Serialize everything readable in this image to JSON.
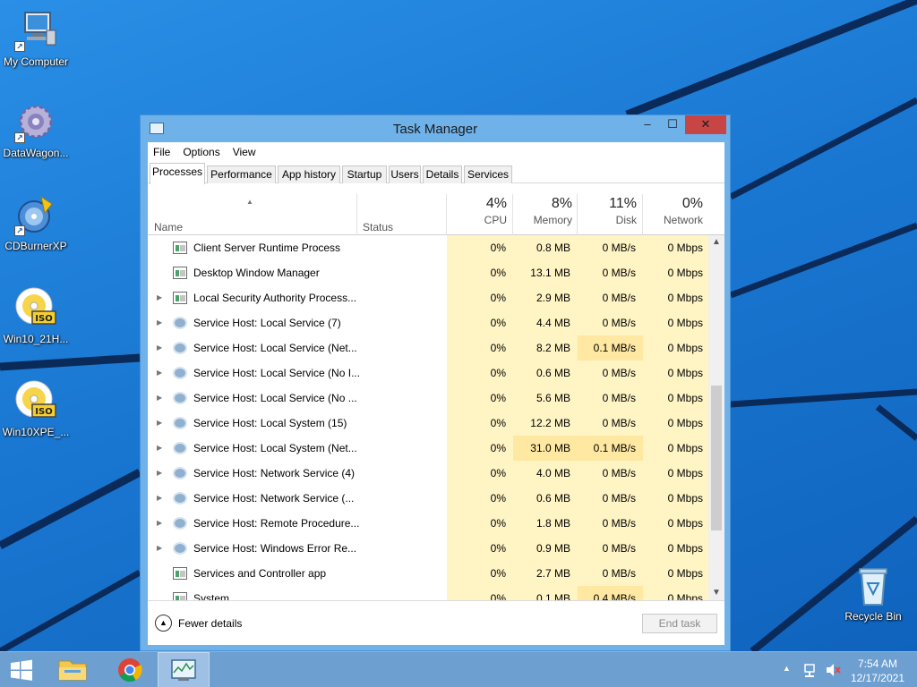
{
  "desktop": {
    "icons": [
      {
        "label": "My Computer",
        "icon": "computer-icon"
      },
      {
        "label": "DataWagon...",
        "icon": "datawagon-icon"
      },
      {
        "label": "CDBurnerXP",
        "icon": "cdburner-icon"
      },
      {
        "label": "Win10_21H...",
        "icon": "iso-disc-icon",
        "badge": "ISO"
      },
      {
        "label": "Win10XPE_...",
        "icon": "iso-disc-icon",
        "badge": "ISO"
      },
      {
        "label": "Recycle Bin",
        "icon": "recycle-bin-icon"
      }
    ]
  },
  "window": {
    "title": "Task Manager",
    "minimize": "–",
    "maximize": "☐",
    "close": "✕",
    "menu": [
      "File",
      "Options",
      "View"
    ],
    "tabs": [
      "Processes",
      "Performance",
      "App history",
      "Startup",
      "Users",
      "Details",
      "Services"
    ],
    "active_tab": "Processes",
    "columns": {
      "name": "Name",
      "status": "Status",
      "cpu": {
        "pct": "4%",
        "label": "CPU"
      },
      "memory": {
        "pct": "8%",
        "label": "Memory"
      },
      "disk": {
        "pct": "11%",
        "label": "Disk"
      },
      "network": {
        "pct": "0%",
        "label": "Network"
      }
    },
    "rows": [
      {
        "name": "Client Server Runtime Process",
        "icon": "app",
        "expand": false,
        "cpu": "0%",
        "memory": "0.8 MB",
        "disk": "0 MB/s",
        "network": "0 Mbps"
      },
      {
        "name": "Desktop Window Manager",
        "icon": "app",
        "expand": false,
        "cpu": "0%",
        "memory": "13.1 MB",
        "disk": "0 MB/s",
        "network": "0 Mbps"
      },
      {
        "name": "Local Security Authority Process...",
        "icon": "app",
        "expand": true,
        "cpu": "0%",
        "memory": "2.9 MB",
        "disk": "0 MB/s",
        "network": "0 Mbps"
      },
      {
        "name": "Service Host: Local Service (7)",
        "icon": "gear",
        "expand": true,
        "cpu": "0%",
        "memory": "4.4 MB",
        "disk": "0 MB/s",
        "network": "0 Mbps"
      },
      {
        "name": "Service Host: Local Service (Net...",
        "icon": "gear",
        "expand": true,
        "cpu": "0%",
        "memory": "8.2 MB",
        "disk": "0.1 MB/s",
        "network": "0 Mbps",
        "disk_hot": true
      },
      {
        "name": "Service Host: Local Service (No I...",
        "icon": "gear",
        "expand": true,
        "cpu": "0%",
        "memory": "0.6 MB",
        "disk": "0 MB/s",
        "network": "0 Mbps"
      },
      {
        "name": "Service Host: Local Service (No ...",
        "icon": "gear",
        "expand": true,
        "cpu": "0%",
        "memory": "5.6 MB",
        "disk": "0 MB/s",
        "network": "0 Mbps"
      },
      {
        "name": "Service Host: Local System (15)",
        "icon": "gear",
        "expand": true,
        "cpu": "0%",
        "memory": "12.2 MB",
        "disk": "0 MB/s",
        "network": "0 Mbps"
      },
      {
        "name": "Service Host: Local System (Net...",
        "icon": "gear",
        "expand": true,
        "cpu": "0%",
        "memory": "31.0 MB",
        "disk": "0.1 MB/s",
        "network": "0 Mbps",
        "disk_hot": true,
        "mem_hot": true
      },
      {
        "name": "Service Host: Network Service (4)",
        "icon": "gear",
        "expand": true,
        "cpu": "0%",
        "memory": "4.0 MB",
        "disk": "0 MB/s",
        "network": "0 Mbps"
      },
      {
        "name": "Service Host: Network Service (...",
        "icon": "gear",
        "expand": true,
        "cpu": "0%",
        "memory": "0.6 MB",
        "disk": "0 MB/s",
        "network": "0 Mbps"
      },
      {
        "name": "Service Host: Remote Procedure...",
        "icon": "gear",
        "expand": true,
        "cpu": "0%",
        "memory": "1.8 MB",
        "disk": "0 MB/s",
        "network": "0 Mbps"
      },
      {
        "name": "Service Host: Windows Error Re...",
        "icon": "gear",
        "expand": true,
        "cpu": "0%",
        "memory": "0.9 MB",
        "disk": "0 MB/s",
        "network": "0 Mbps"
      },
      {
        "name": "Services and Controller app",
        "icon": "app",
        "expand": false,
        "cpu": "0%",
        "memory": "2.7 MB",
        "disk": "0 MB/s",
        "network": "0 Mbps"
      },
      {
        "name": "System",
        "icon": "app",
        "expand": false,
        "cpu": "0%",
        "memory": "0.1 MB",
        "disk": "0.4 MB/s",
        "network": "0 Mbps",
        "disk_hot": true
      }
    ],
    "fewer_details": "Fewer details",
    "end_task": "End task"
  },
  "taskbar": {
    "time": "7:54 AM",
    "date": "12/17/2021",
    "tray_icons": [
      "show-hidden-icons",
      "network-icon",
      "volume-muted-icon"
    ]
  },
  "colors": {
    "desktop": "#1a78d2",
    "window_frame": "#6fb2ea",
    "close_button": "#c74545",
    "metric_tint": "#fff4c4",
    "metric_hot": "#ffe8a1",
    "taskbar": "#6d9fd0"
  }
}
